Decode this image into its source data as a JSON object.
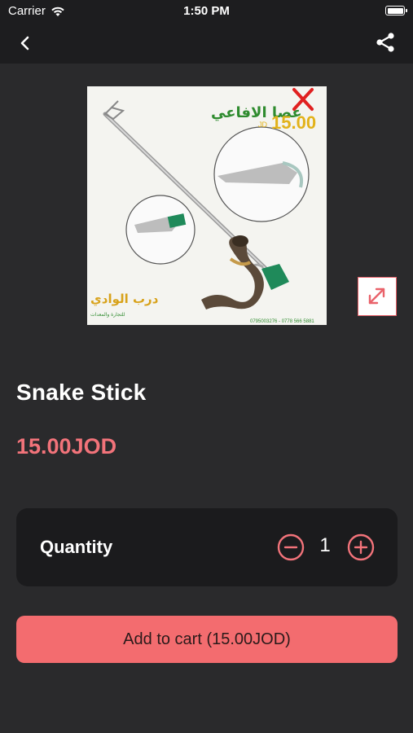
{
  "status_bar": {
    "carrier": "Carrier",
    "time": "1:50 PM"
  },
  "nav": {
    "back_icon": "chevron-left-icon",
    "share_icon": "share-icon"
  },
  "product": {
    "title": "Snake Stick",
    "price": "15.00JOD",
    "image": {
      "arabic_title": "عصا الافاعي",
      "price_tag": "15.00",
      "price_currency": "JD",
      "brand": "درب الوادي",
      "brand_tagline": "للتجارة والمعدات",
      "phone": "0795003276 - 0778 566 5881"
    }
  },
  "quantity": {
    "label": "Quantity",
    "value": "1"
  },
  "cart_button": {
    "label": "Add to cart (15.00JOD)"
  },
  "colors": {
    "accent": "#f36c6f",
    "background": "#2a2a2c",
    "card": "#1b1b1d"
  }
}
